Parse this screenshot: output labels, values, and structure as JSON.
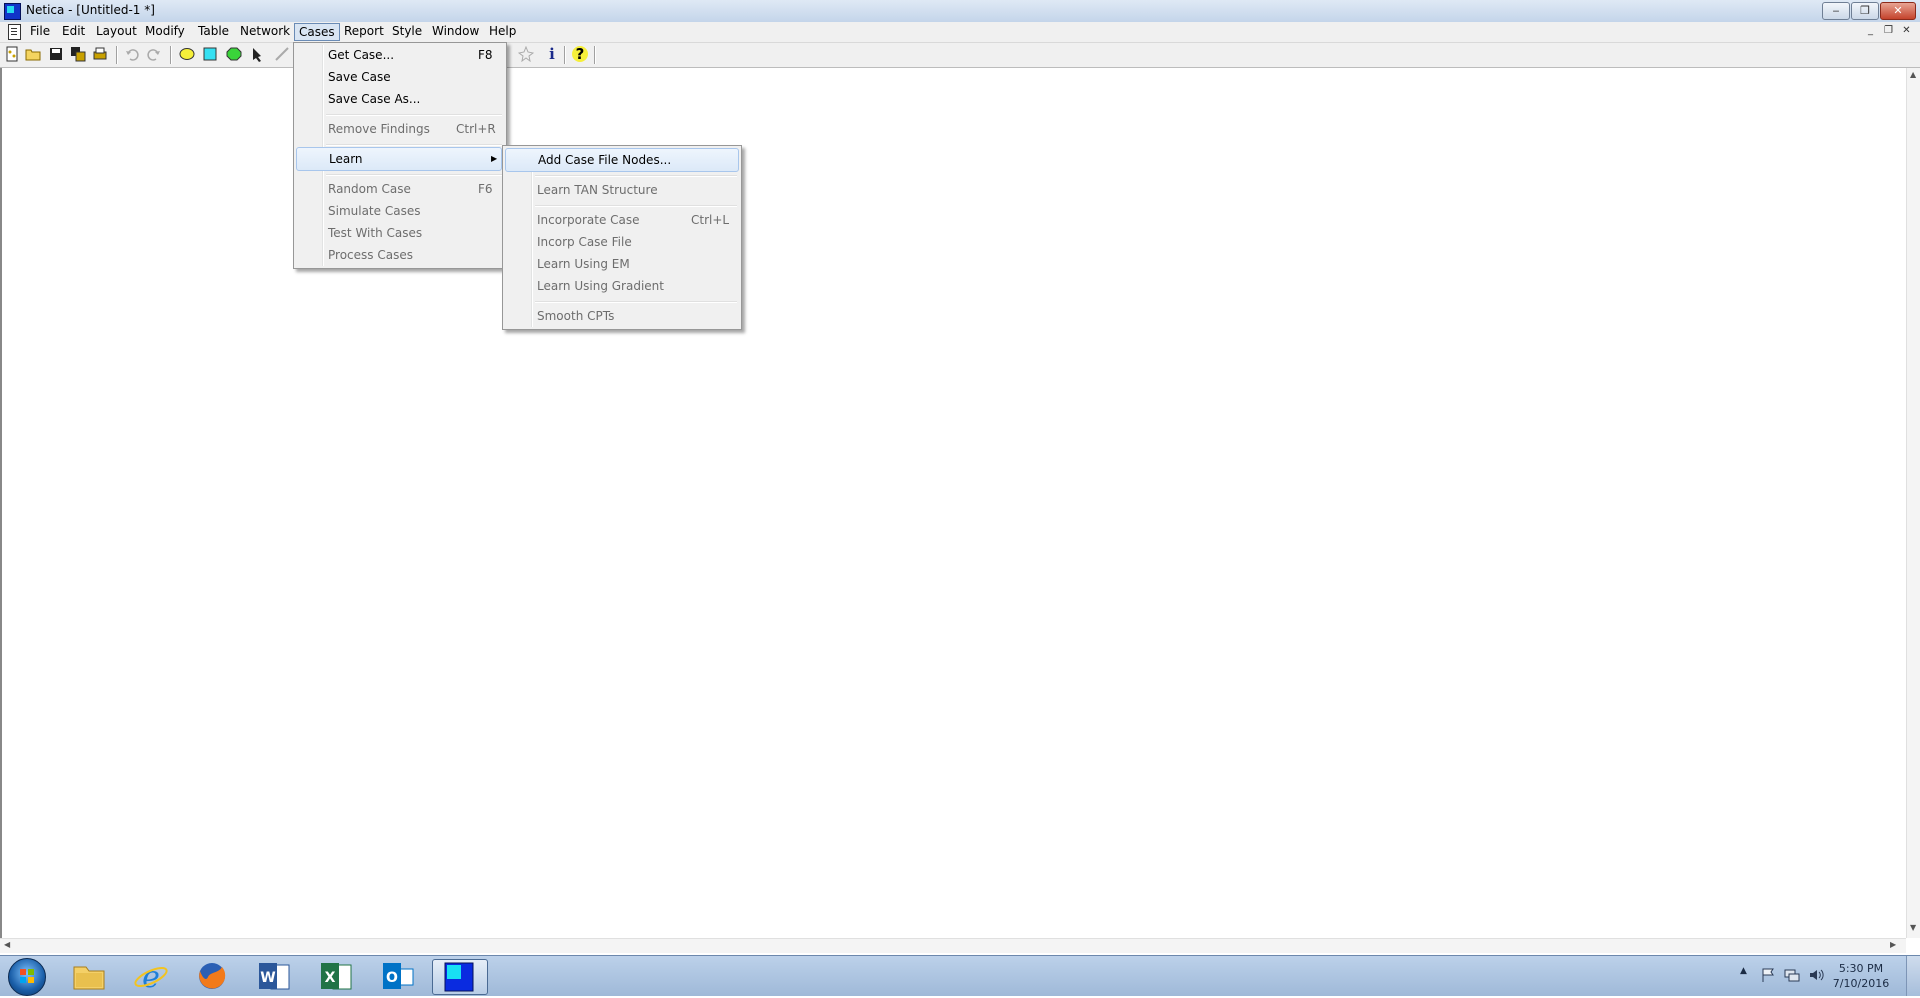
{
  "window": {
    "title": "Netica - [Untitled-1 *]",
    "controls": {
      "minimize": "‒",
      "restore": "❐",
      "close": "✕"
    }
  },
  "mdi_controls": {
    "minimize": "_",
    "restore": "❐",
    "close": "✕"
  },
  "menubar": [
    "File",
    "Edit",
    "Layout",
    "Modify",
    "Table",
    "Network",
    "Cases",
    "Report",
    "Style",
    "Window",
    "Help"
  ],
  "active_menu": "Cases",
  "cases_menu": {
    "items": [
      {
        "label": "Get Case...",
        "shortcut": "F8",
        "disabled": false
      },
      {
        "label": "Save Case",
        "shortcut": "",
        "disabled": false
      },
      {
        "label": "Save Case As...",
        "shortcut": "",
        "disabled": false
      },
      {
        "label": "Remove Findings",
        "shortcut": "Ctrl+R",
        "disabled": true
      },
      {
        "label": "Learn",
        "shortcut": "",
        "disabled": false,
        "submenu": true
      },
      {
        "label": "Random Case",
        "shortcut": "F6",
        "disabled": true
      },
      {
        "label": "Simulate Cases",
        "shortcut": "",
        "disabled": true
      },
      {
        "label": "Test With Cases",
        "shortcut": "",
        "disabled": true
      },
      {
        "label": "Process Cases",
        "shortcut": "",
        "disabled": true
      }
    ]
  },
  "learn_submenu": {
    "items": [
      {
        "label": "Add Case File Nodes...",
        "shortcut": "",
        "disabled": false
      },
      {
        "label": "Learn TAN Structure",
        "shortcut": "",
        "disabled": true
      },
      {
        "label": "Incorporate Case",
        "shortcut": "Ctrl+L",
        "disabled": true
      },
      {
        "label": "Incorp Case File",
        "shortcut": "",
        "disabled": true
      },
      {
        "label": "Learn Using EM",
        "shortcut": "",
        "disabled": true
      },
      {
        "label": "Learn Using Gradient",
        "shortcut": "",
        "disabled": true
      },
      {
        "label": "Smooth CPTs",
        "shortcut": "",
        "disabled": true
      }
    ]
  },
  "toolbar_icons": [
    "new-network-icon",
    "open-icon",
    "save-icon",
    "save-all-icon",
    "print-icon",
    "undo-icon",
    "redo-icon",
    "add-nature-node-icon",
    "add-decision-node-icon",
    "add-utility-node-icon",
    "add-link-icon",
    "properties-icon",
    "info-icon",
    "help-icon"
  ],
  "taskbar": {
    "apps": [
      "windows-explorer-icon",
      "internet-explorer-icon",
      "firefox-icon",
      "word-icon",
      "excel-icon",
      "outlook-icon",
      "netica-icon"
    ],
    "clock_time": "5:30 PM",
    "clock_date": "7/10/2016"
  },
  "colors": {
    "menu_bg": "#f0f0f0",
    "highlight": "#dce9f8",
    "taskbar": "#a9c1de",
    "netica_icon": "#1034c8"
  }
}
